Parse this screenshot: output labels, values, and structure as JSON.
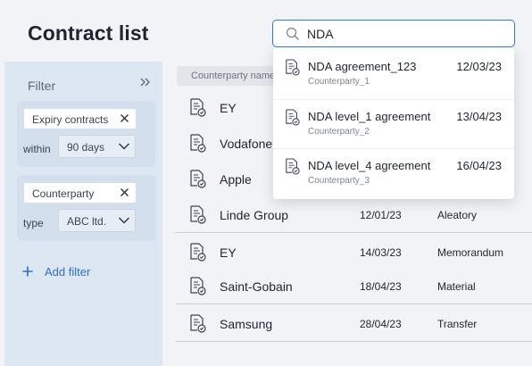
{
  "page": {
    "title": "Contract list"
  },
  "sidebar": {
    "title": "Filter",
    "filters": [
      {
        "chip": "Expiry contracts",
        "row_label": "within",
        "select_value": "90 days"
      },
      {
        "chip": "Counterparty",
        "row_label": "type",
        "select_value": "ABC ltd."
      }
    ],
    "add_filter_label": "Add filter"
  },
  "table": {
    "header_counterparty": "Counterparty name",
    "rows": [
      {
        "counterparty": "EY",
        "date": "",
        "type": ""
      },
      {
        "counterparty": "Vodafone",
        "date": "",
        "type": ""
      },
      {
        "counterparty": "Apple",
        "date": "",
        "type": ""
      },
      {
        "counterparty": "Linde Group",
        "date": "12/01/23",
        "type": "Aleatory"
      },
      {
        "counterparty": "EY",
        "date": "14/03/23",
        "type": "Memorandum"
      },
      {
        "counterparty": "Saint-Gobain",
        "date": "18/04/23",
        "type": "Material"
      },
      {
        "counterparty": "Samsung",
        "date": "28/04/23",
        "type": "Transfer"
      }
    ]
  },
  "search": {
    "value": "NDA",
    "results": [
      {
        "name": "NDA agreement_123",
        "date": "12/03/23",
        "counterparty": "Counterparty_1"
      },
      {
        "name": "NDA level_1 agreement",
        "date": "13/04/23",
        "counterparty": "Counterparty_2"
      },
      {
        "name": "NDA level_4 agreement",
        "date": "16/04/23",
        "counterparty": "Counterparty_3"
      }
    ]
  },
  "colors": {
    "accent": "#2c7be5",
    "link": "#2c6fd1",
    "sidebar_bg": "#dce7f2",
    "page_bg": "#f1f3f6"
  },
  "icons": {
    "collapse": "double-chevron-right-icon",
    "chip_close": "close-icon",
    "select": "chevron-down-icon",
    "add": "plus-icon",
    "document": "contract-document-icon",
    "search": "search-icon"
  }
}
